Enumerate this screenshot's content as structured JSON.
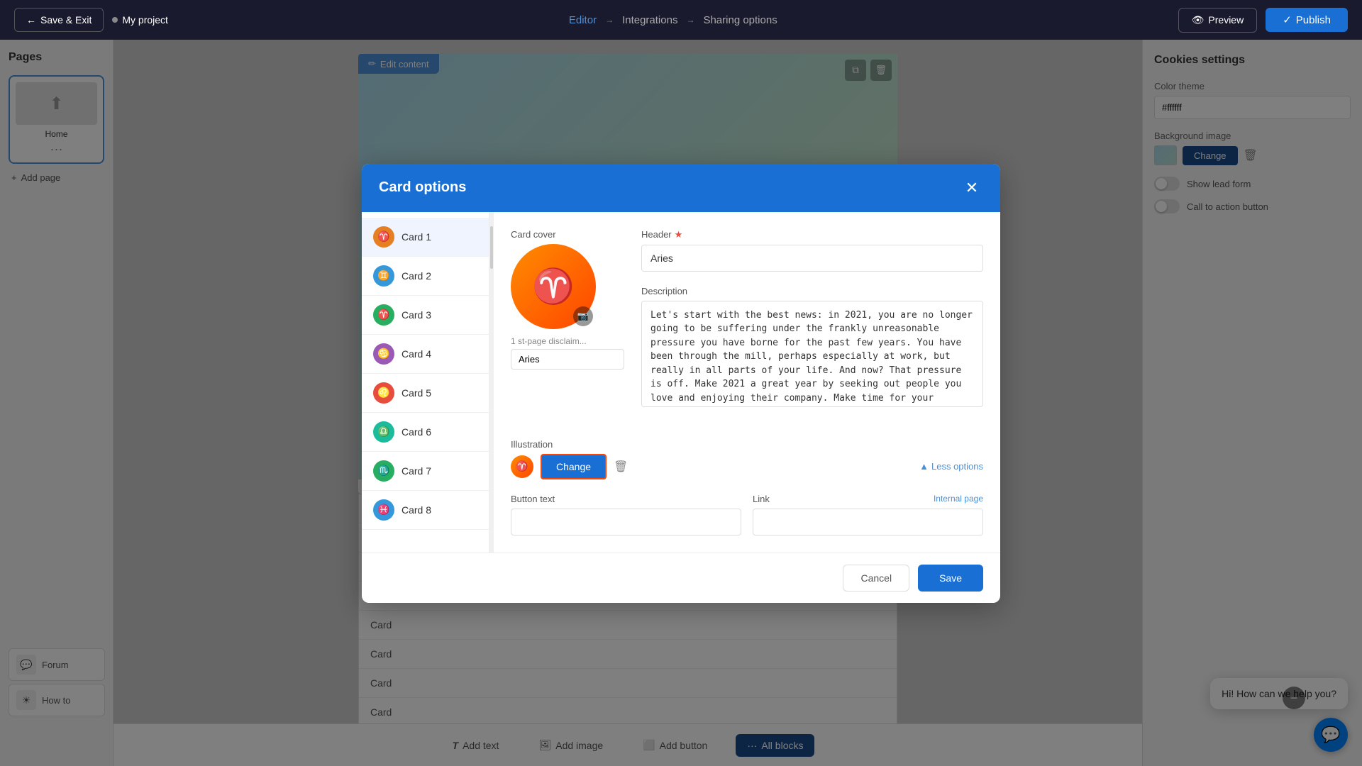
{
  "topNav": {
    "saveExitLabel": "Save & Exit",
    "projectName": "My project",
    "steps": [
      {
        "label": "Editor",
        "active": true
      },
      {
        "label": "Integrations",
        "active": false
      },
      {
        "label": "Sharing options",
        "active": false
      }
    ],
    "previewLabel": "Preview",
    "publishLabel": "Publish"
  },
  "pagesSidebar": {
    "title": "Pages",
    "pages": [
      {
        "label": "Home"
      }
    ],
    "addPageLabel": "Add page"
  },
  "rightSidebar": {
    "title": "Cookies settings",
    "colorThemeLabel": "Color theme",
    "colorThemeValue": "#ffffff",
    "backgroundImageLabel": "Background image",
    "changeLabel": "Change",
    "showLeadFormLabel": "Show lead form",
    "callToActionLabel": "Call to action button"
  },
  "bottomToolbar": {
    "items": [
      {
        "label": "Add text",
        "icon": "T"
      },
      {
        "label": "Add image",
        "icon": "🖼"
      },
      {
        "label": "Add button",
        "icon": "⬜"
      },
      {
        "label": "All blocks",
        "icon": "···",
        "active": true
      }
    ]
  },
  "bottomLeftItems": [
    {
      "label": "Forum",
      "icon": "💬"
    },
    {
      "label": "How to",
      "icon": "☀"
    }
  ],
  "chat": {
    "message": "Hi! How can we help you?"
  },
  "modal": {
    "title": "Card options",
    "cards": [
      {
        "label": "Card 1",
        "color": "#e67e22",
        "symbol": "♈"
      },
      {
        "label": "Card 2",
        "color": "#3498db",
        "symbol": "♊"
      },
      {
        "label": "Card 3",
        "color": "#27ae60",
        "symbol": "♈"
      },
      {
        "label": "Card 4",
        "color": "#9b59b6",
        "symbol": "♋"
      },
      {
        "label": "Card 5",
        "color": "#e74c3c",
        "symbol": "♌"
      },
      {
        "label": "Card 6",
        "color": "#1abc9c",
        "symbol": "♎"
      },
      {
        "label": "Card 7",
        "color": "#27ae60",
        "symbol": "♏"
      },
      {
        "label": "Card 8",
        "color": "#3498db",
        "symbol": "♓"
      }
    ],
    "activeCardIndex": 0,
    "cardCoverLabel": "Card cover",
    "disclaimerLabel": "1 st-page disclaim...",
    "disclaimerValue": "Aries",
    "headerLabel": "Header",
    "headerRequired": true,
    "headerValue": "Aries",
    "descriptionLabel": "Description",
    "descriptionValue": "Let's start with the best news: in 2021, you are no longer going to be suffering under the frankly unreasonable pressure you have borne for the past few years. You have been through the mill, perhaps especially at work, but really in all parts of your life. And now? That pressure is off. Make 2021 a great year by seeking out people you love and enjoying their company. Make time for your friends. Your social circle can really widen this year. It really is a year to breathe out.",
    "illustrationLabel": "Illustration",
    "changeIllustrationLabel": "Change",
    "lessOptionsLabel": "Less options",
    "buttonTextLabel": "Button text",
    "buttonTextValue": "",
    "linkLabel": "Link",
    "linkValue": "",
    "internalPageLabel": "Internal page",
    "cancelLabel": "Cancel",
    "saveLabel": "Save"
  }
}
